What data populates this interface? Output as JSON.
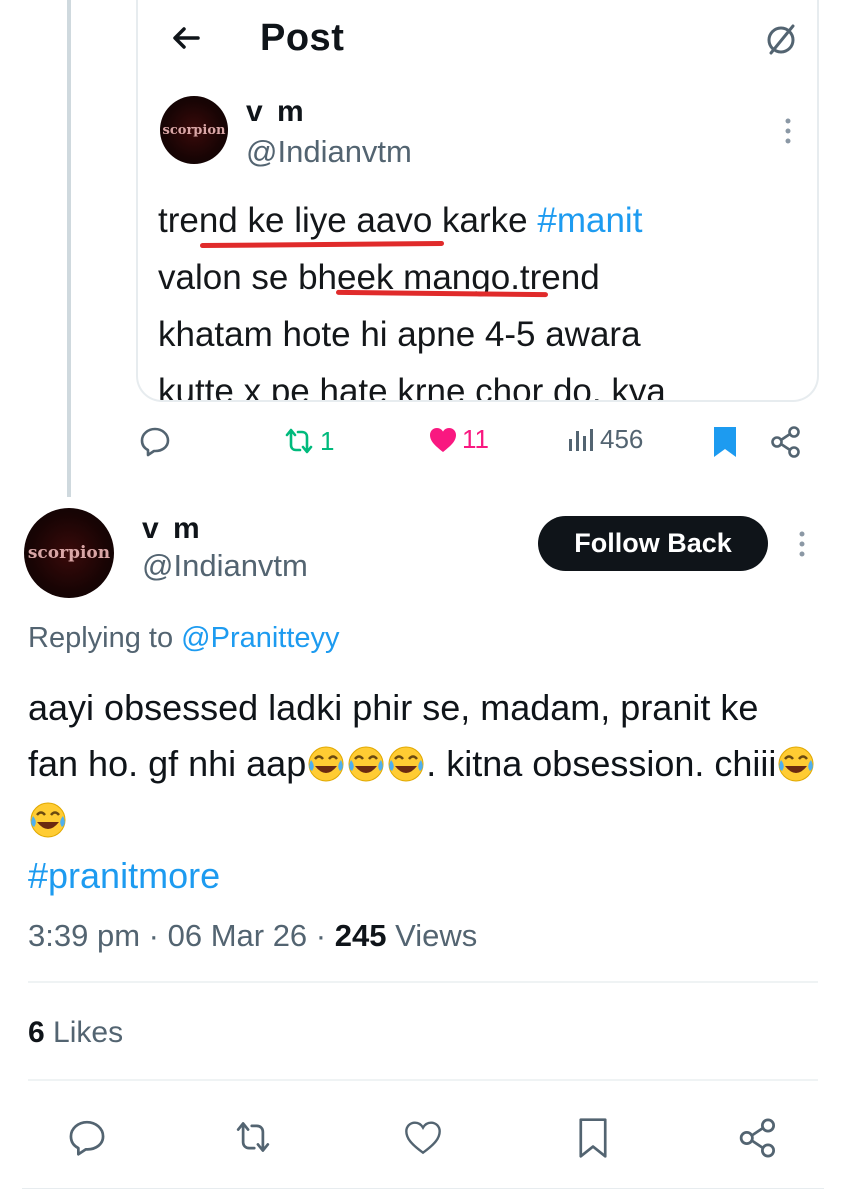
{
  "quoted_post": {
    "header_title": "Post",
    "author_name": "v m",
    "author_handle": "@Indianvtm",
    "avatar_text": "scorpion",
    "text_line1_prefix": "trend ke liye aavo karke ",
    "text_line1_hashtag": "#manit",
    "text_line2": "valon se bheek mango.trend",
    "text_line3": "khatam hote hi apne 4-5 awara",
    "text_line4": "kutte x pe hate krne chor do. kya",
    "reposts": "1",
    "likes": "11",
    "views": "456",
    "colors": {
      "repost": "#00ba7c",
      "like": "#f91880",
      "bookmark": "#1d9bf0",
      "annotation_underline": "#e02b2b"
    }
  },
  "reply_post": {
    "author_name": "v m",
    "author_handle": "@Indianvtm",
    "avatar_text": "scorpion",
    "follow_label": "Follow Back",
    "replying_prefix": "Replying to ",
    "replying_mention": "@Pranitteyy",
    "text_part1": "aayi obsessed ladki phir se, madam, pranit ke fan ho. gf nhi aap",
    "text_part2": ". kitna obsession. chiii",
    "hashtag": "#pranitmore",
    "time": "3:39 pm",
    "date": "06 Mar 26",
    "views_count": "245",
    "views_label": "Views",
    "likes_count": "6",
    "likes_label": "Likes"
  },
  "icons": {
    "back": "arrow-left-icon",
    "slash": "slashed-circle-icon",
    "reply": "reply-bubble-icon",
    "repost": "repost-icon",
    "like": "heart-icon",
    "views": "views-bar-icon",
    "bookmark": "bookmark-icon",
    "share": "share-icon",
    "more": "more-vertical-icon",
    "emoji": "tears-of-joy-emoji"
  },
  "separator": "·"
}
